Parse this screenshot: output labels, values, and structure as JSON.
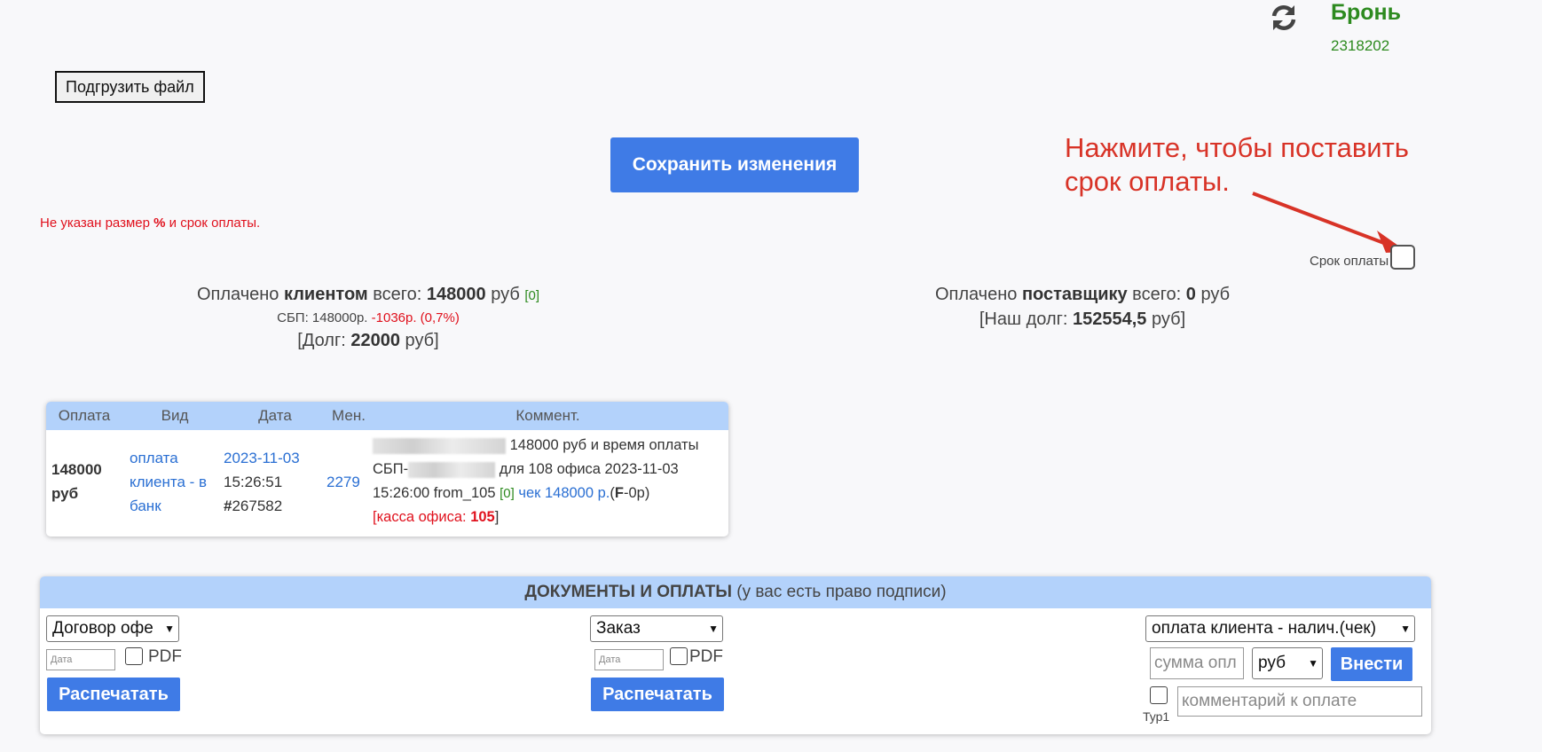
{
  "header": {
    "refresh_icon": "refresh-icon",
    "booking_title": "Бронь",
    "booking_number": "2318202"
  },
  "upload_button": "Подгрузить файл",
  "save_button": "Сохранить изменения",
  "annotation": {
    "line1": "Нажмите, чтобы поставить",
    "line2": "срок оплаты.",
    "color": "#d83327"
  },
  "warning": {
    "prefix": "Не указан размер ",
    "percent": "%",
    "suffix": " и срок оплаты."
  },
  "deadline": {
    "label": "Срок оплаты",
    "checked": false
  },
  "client_summary": {
    "paid_prefix": "Оплачено ",
    "paid_who": "клиентом",
    "paid_mid": " всего: ",
    "paid_amount": "148000",
    "paid_unit": " руб ",
    "paid_count": "[0]",
    "sbp_text": "СБП: 148000р. ",
    "sbp_fee": "-1036р. (0,7%)",
    "debt_prefix": "[Долг: ",
    "debt_amount": "22000",
    "debt_suffix": " руб]"
  },
  "supplier_summary": {
    "paid_prefix": "Оплачено ",
    "paid_who": "поставщику",
    "paid_mid": " всего: ",
    "paid_amount": "0",
    "paid_unit": " руб",
    "debt_prefix": "[Наш долг: ",
    "debt_amount": "152554,5",
    "debt_suffix": " руб]"
  },
  "payments_table": {
    "columns": [
      "Оплата",
      "Вид",
      "Дата",
      "Мен.",
      "Коммент."
    ],
    "rows": [
      {
        "amount": "148000 руб",
        "type": "оплата клиента - в банк",
        "date": "2023-11-03",
        "time": "15:26:51",
        "id_hash": "#",
        "id_num": "267582",
        "manager": "2279",
        "comment_part1": "148000 руб и время оплаты СБП-",
        "comment_part2": " для 108 офиса 2023-11-03 15:26:00 from_105 ",
        "comment_count": "[0]",
        "comment_check": "чек 148000 р.",
        "comment_f_open": "(",
        "comment_f": "F",
        "comment_f_close": "-0р)",
        "cash_open": "[",
        "cash_label": "касса офиса: ",
        "cash_num": "105",
        "cash_close": "]"
      }
    ]
  },
  "documents": {
    "title": "ДОКУМЕНТЫ И ОПЛАТЫ",
    "subtitle": " (у вас есть право подписи)",
    "contract_select": "Договор офе",
    "order_select": "Заказ",
    "date_placeholder": "Дата",
    "pdf_label": "PDF",
    "print_button": "Распечатать",
    "payment_type_select": "оплата клиента - налич.(чек)",
    "amount_placeholder": "сумма опл",
    "currency_select": "руб",
    "submit_button": "Внести",
    "typ_label": "Тур1",
    "comment_placeholder": "комментарий к оплате"
  }
}
